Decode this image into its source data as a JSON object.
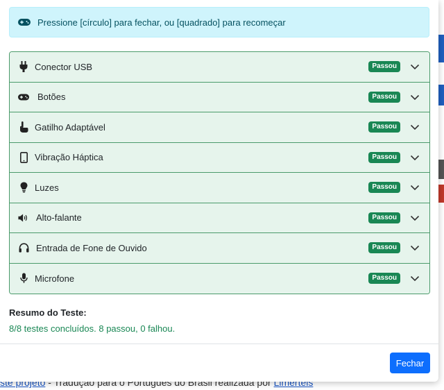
{
  "alert": {
    "text": "Pressione [círculo] para fechar, ou [quadrado] para recomeçar",
    "icon": "gamepad-icon"
  },
  "tests": [
    {
      "label": "Conector USB",
      "status": "Passou",
      "icon": "plug-icon"
    },
    {
      "label": "Botões",
      "status": "Passou",
      "icon": "gamepad-icon"
    },
    {
      "label": "Gatilho Adaptável",
      "status": "Passou",
      "icon": "hand-pointer-icon"
    },
    {
      "label": "Vibração Háptica",
      "status": "Passou",
      "icon": "phone-icon"
    },
    {
      "label": "Luzes",
      "status": "Passou",
      "icon": "lightbulb-icon"
    },
    {
      "label": "Alto-falante",
      "status": "Passou",
      "icon": "speaker-icon"
    },
    {
      "label": "Entrada de Fone de Ouvido",
      "status": "Passou",
      "icon": "headphones-icon"
    },
    {
      "label": "Microfone",
      "status": "Passou",
      "icon": "microphone-icon"
    }
  ],
  "summary": {
    "title": "Resumo do Teste:",
    "text": "8/8 testes concluídos. 8 passou, 0 falhou."
  },
  "close_label": "Fechar",
  "background": {
    "footer_link": "ste projeto",
    "footer_text": " - Tradução para o Português do Brasil realizada por ",
    "footer_link2": "Limerteis"
  },
  "colors": {
    "alert_bg": "#cff4fc",
    "item_bg": "#e6f4ec",
    "badge": "#198754",
    "primary": "#0d6efd",
    "success_text": "#198754"
  }
}
